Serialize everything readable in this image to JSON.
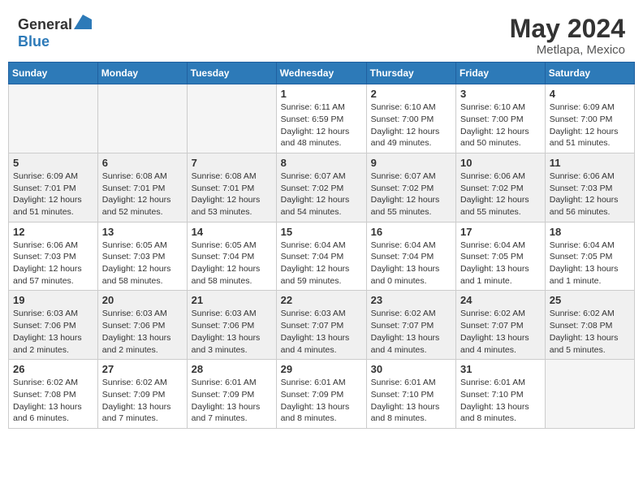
{
  "header": {
    "logo_general": "General",
    "logo_blue": "Blue",
    "month": "May 2024",
    "location": "Metlapa, Mexico"
  },
  "weekdays": [
    "Sunday",
    "Monday",
    "Tuesday",
    "Wednesday",
    "Thursday",
    "Friday",
    "Saturday"
  ],
  "weeks": [
    [
      {
        "day": "",
        "info": ""
      },
      {
        "day": "",
        "info": ""
      },
      {
        "day": "",
        "info": ""
      },
      {
        "day": "1",
        "info": "Sunrise: 6:11 AM\nSunset: 6:59 PM\nDaylight: 12 hours\nand 48 minutes."
      },
      {
        "day": "2",
        "info": "Sunrise: 6:10 AM\nSunset: 7:00 PM\nDaylight: 12 hours\nand 49 minutes."
      },
      {
        "day": "3",
        "info": "Sunrise: 6:10 AM\nSunset: 7:00 PM\nDaylight: 12 hours\nand 50 minutes."
      },
      {
        "day": "4",
        "info": "Sunrise: 6:09 AM\nSunset: 7:00 PM\nDaylight: 12 hours\nand 51 minutes."
      }
    ],
    [
      {
        "day": "5",
        "info": "Sunrise: 6:09 AM\nSunset: 7:01 PM\nDaylight: 12 hours\nand 51 minutes."
      },
      {
        "day": "6",
        "info": "Sunrise: 6:08 AM\nSunset: 7:01 PM\nDaylight: 12 hours\nand 52 minutes."
      },
      {
        "day": "7",
        "info": "Sunrise: 6:08 AM\nSunset: 7:01 PM\nDaylight: 12 hours\nand 53 minutes."
      },
      {
        "day": "8",
        "info": "Sunrise: 6:07 AM\nSunset: 7:02 PM\nDaylight: 12 hours\nand 54 minutes."
      },
      {
        "day": "9",
        "info": "Sunrise: 6:07 AM\nSunset: 7:02 PM\nDaylight: 12 hours\nand 55 minutes."
      },
      {
        "day": "10",
        "info": "Sunrise: 6:06 AM\nSunset: 7:02 PM\nDaylight: 12 hours\nand 55 minutes."
      },
      {
        "day": "11",
        "info": "Sunrise: 6:06 AM\nSunset: 7:03 PM\nDaylight: 12 hours\nand 56 minutes."
      }
    ],
    [
      {
        "day": "12",
        "info": "Sunrise: 6:06 AM\nSunset: 7:03 PM\nDaylight: 12 hours\nand 57 minutes."
      },
      {
        "day": "13",
        "info": "Sunrise: 6:05 AM\nSunset: 7:03 PM\nDaylight: 12 hours\nand 58 minutes."
      },
      {
        "day": "14",
        "info": "Sunrise: 6:05 AM\nSunset: 7:04 PM\nDaylight: 12 hours\nand 58 minutes."
      },
      {
        "day": "15",
        "info": "Sunrise: 6:04 AM\nSunset: 7:04 PM\nDaylight: 12 hours\nand 59 minutes."
      },
      {
        "day": "16",
        "info": "Sunrise: 6:04 AM\nSunset: 7:04 PM\nDaylight: 13 hours\nand 0 minutes."
      },
      {
        "day": "17",
        "info": "Sunrise: 6:04 AM\nSunset: 7:05 PM\nDaylight: 13 hours\nand 1 minute."
      },
      {
        "day": "18",
        "info": "Sunrise: 6:04 AM\nSunset: 7:05 PM\nDaylight: 13 hours\nand 1 minute."
      }
    ],
    [
      {
        "day": "19",
        "info": "Sunrise: 6:03 AM\nSunset: 7:06 PM\nDaylight: 13 hours\nand 2 minutes."
      },
      {
        "day": "20",
        "info": "Sunrise: 6:03 AM\nSunset: 7:06 PM\nDaylight: 13 hours\nand 2 minutes."
      },
      {
        "day": "21",
        "info": "Sunrise: 6:03 AM\nSunset: 7:06 PM\nDaylight: 13 hours\nand 3 minutes."
      },
      {
        "day": "22",
        "info": "Sunrise: 6:03 AM\nSunset: 7:07 PM\nDaylight: 13 hours\nand 4 minutes."
      },
      {
        "day": "23",
        "info": "Sunrise: 6:02 AM\nSunset: 7:07 PM\nDaylight: 13 hours\nand 4 minutes."
      },
      {
        "day": "24",
        "info": "Sunrise: 6:02 AM\nSunset: 7:07 PM\nDaylight: 13 hours\nand 4 minutes."
      },
      {
        "day": "25",
        "info": "Sunrise: 6:02 AM\nSunset: 7:08 PM\nDaylight: 13 hours\nand 5 minutes."
      }
    ],
    [
      {
        "day": "26",
        "info": "Sunrise: 6:02 AM\nSunset: 7:08 PM\nDaylight: 13 hours\nand 6 minutes."
      },
      {
        "day": "27",
        "info": "Sunrise: 6:02 AM\nSunset: 7:09 PM\nDaylight: 13 hours\nand 7 minutes."
      },
      {
        "day": "28",
        "info": "Sunrise: 6:01 AM\nSunset: 7:09 PM\nDaylight: 13 hours\nand 7 minutes."
      },
      {
        "day": "29",
        "info": "Sunrise: 6:01 AM\nSunset: 7:09 PM\nDaylight: 13 hours\nand 8 minutes."
      },
      {
        "day": "30",
        "info": "Sunrise: 6:01 AM\nSunset: 7:10 PM\nDaylight: 13 hours\nand 8 minutes."
      },
      {
        "day": "31",
        "info": "Sunrise: 6:01 AM\nSunset: 7:10 PM\nDaylight: 13 hours\nand 8 minutes."
      },
      {
        "day": "",
        "info": ""
      }
    ]
  ]
}
